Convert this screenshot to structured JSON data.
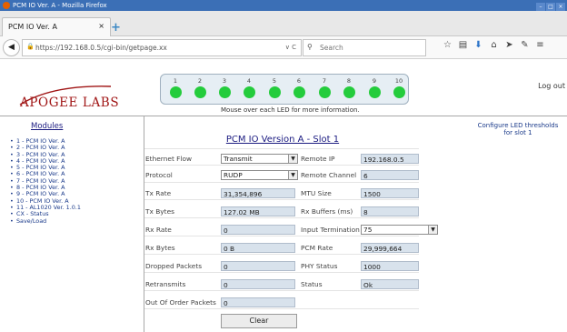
{
  "window": {
    "title": "PCM IO Ver. A - Mozilla Firefox"
  },
  "tab": {
    "title": "PCM IO Ver. A",
    "close": "×",
    "new_tab": "+"
  },
  "nav": {
    "url": "https://192.168.0.5/cgi-bin/getpage.xx",
    "url_controls": "∨ C",
    "search_placeholder": "Search"
  },
  "header": {
    "logo": "APOGEE LABS",
    "leds": [
      "1",
      "2",
      "3",
      "4",
      "5",
      "6",
      "7",
      "8",
      "9",
      "10"
    ],
    "led_color": "#24cc3c",
    "led_hint": "Mouse over each LED for more information.",
    "logout": "Log out"
  },
  "sidebar": {
    "title": "Modules",
    "items": [
      "1 - PCM IO Ver. A",
      "2 - PCM IO Ver. A",
      "3 - PCM IO Ver. A",
      "4 - PCM IO Ver. A",
      "5 - PCM IO Ver. A",
      "6 - PCM IO Ver. A",
      "7 - PCM IO Ver. A",
      "8 - PCM IO Ver. A",
      "9 - PCM IO Ver. A",
      "10 - PCM IO Ver. A",
      "11 - AL1020 Ver. 1.0.1",
      "CX - Status",
      "Save/Load"
    ]
  },
  "config_led_link": "Configure LED thresholds for slot 1",
  "panel": {
    "title": "PCM IO Version A - Slot 1",
    "left": {
      "ethernet_flow": {
        "label": "Ethernet Flow",
        "value": "Transmit"
      },
      "protocol": {
        "label": "Protocol",
        "value": "RUDP"
      },
      "tx_rate": {
        "label": "Tx Rate",
        "value": "31,354,896"
      },
      "tx_bytes": {
        "label": "Tx Bytes",
        "value": "127.02 MB"
      },
      "rx_rate": {
        "label": "Rx Rate",
        "value": "0"
      },
      "rx_bytes": {
        "label": "Rx Bytes",
        "value": "0 B"
      },
      "dropped": {
        "label": "Dropped Packets",
        "value": "0"
      },
      "retransmits": {
        "label": "Retransmits",
        "value": "0"
      },
      "out_of_order": {
        "label": "Out Of Order Packets",
        "value": "0"
      }
    },
    "right": {
      "remote_ip": {
        "label": "Remote IP",
        "value": "192.168.0.5"
      },
      "remote_channel": {
        "label": "Remote Channel",
        "value": "6"
      },
      "mtu": {
        "label": "MTU Size",
        "value": "1500"
      },
      "rx_buffers": {
        "label": "Rx Buffers (ms)",
        "value": "8"
      },
      "input_termination": {
        "label": "Input Termination",
        "value": "75"
      },
      "pcm_rate": {
        "label": "PCM Rate",
        "value": "29,999,664"
      },
      "phy_status": {
        "label": "PHY Status",
        "value": "1000"
      },
      "status": {
        "label": "Status",
        "value": "Ok"
      }
    },
    "clear_label": "Clear"
  }
}
